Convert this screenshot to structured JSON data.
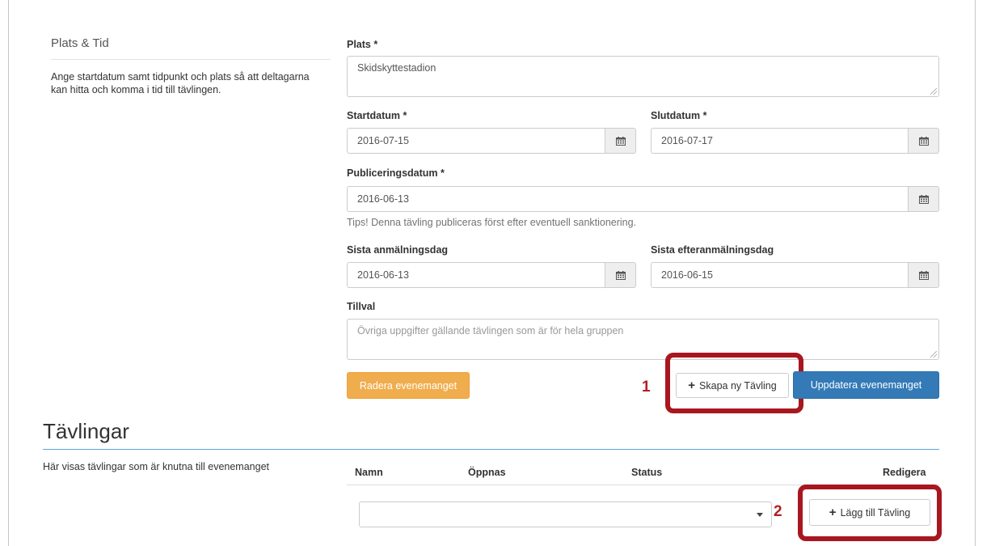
{
  "section": {
    "title": "Plats & Tid",
    "description": "Ange startdatum samt tidpunkt och plats så att deltagarna kan hitta och komma i tid till tävlingen."
  },
  "form": {
    "plats": {
      "label": "Plats *",
      "value": "Skidskyttestadion"
    },
    "startdatum": {
      "label": "Startdatum *",
      "value": "2016-07-15"
    },
    "slutdatum": {
      "label": "Slutdatum *",
      "value": "2016-07-17"
    },
    "publiceringsdatum": {
      "label": "Publiceringsdatum *",
      "value": "2016-06-13",
      "hint": "Tips! Denna tävling publiceras först efter eventuell sanktionering."
    },
    "sista_anmalningsdag": {
      "label": "Sista anmälningsdag",
      "value": "2016-06-13"
    },
    "sista_efteranmalningsdag": {
      "label": "Sista efteranmälningsdag",
      "value": "2016-06-15"
    },
    "tillval": {
      "label": "Tillval",
      "placeholder": "Övriga uppgifter gällande tävlingen som är för hela gruppen"
    }
  },
  "buttons": {
    "delete": "Radera evenemanget",
    "create_competition": "Skapa ny Tävling",
    "update": "Uppdatera evenemanget",
    "add_competition": "Lägg till Tävling"
  },
  "callouts": {
    "one": "1",
    "two": "2"
  },
  "competitions": {
    "heading": "Tävlingar",
    "description": "Här visas tävlingar som är knutna till evenemanget",
    "columns": [
      "Namn",
      "Öppnas",
      "Status",
      "Redigera"
    ],
    "select_value": ""
  },
  "colors": {
    "warning": "#f0ad4e",
    "primary": "#337ab7",
    "callout": "#a8171f",
    "heading_rule": "#5aa9d6"
  },
  "icons": [
    "calendar-icon",
    "plus-icon",
    "caret-down-icon",
    "resize-grip-icon"
  ]
}
